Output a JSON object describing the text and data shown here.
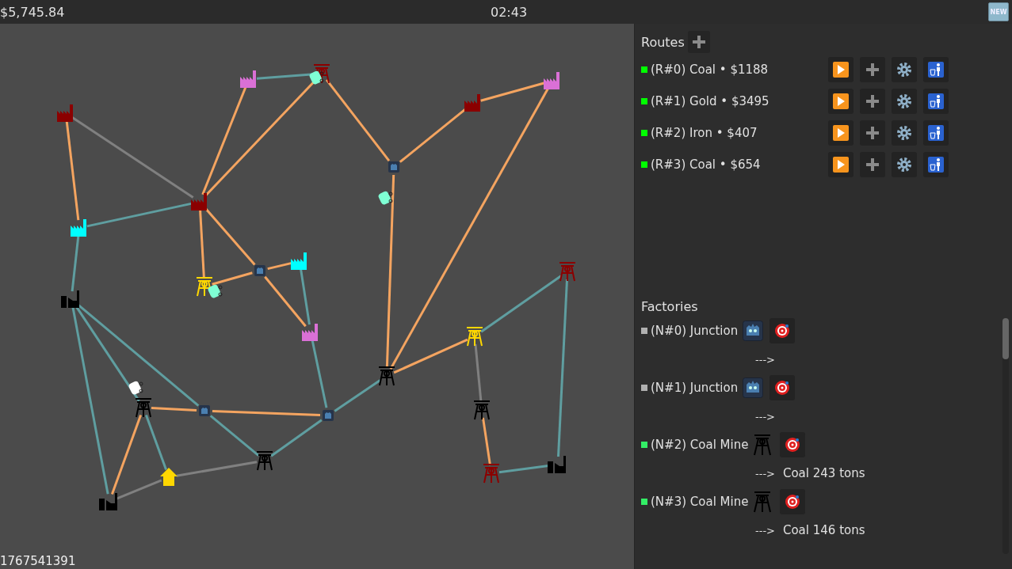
{
  "top_bar": {
    "balance": "$5,745.84",
    "clock": "02:43",
    "new_button": "NEW"
  },
  "map": {
    "seed": "1767541391",
    "nodes": [
      {
        "kind": "factory",
        "color": "#8b0000"
      },
      {
        "kind": "factory",
        "color": "#da70d6"
      },
      {
        "kind": "factory",
        "color": "#8b0000"
      },
      {
        "kind": "factory",
        "color": "#00ffff"
      },
      {
        "kind": "factory",
        "color": "#00ffff"
      },
      {
        "kind": "factory",
        "color": "#da70d6"
      },
      {
        "kind": "factory",
        "color": "#8b0000"
      },
      {
        "kind": "factory",
        "color": "#da70d6"
      },
      {
        "kind": "plant",
        "color": "#000000"
      },
      {
        "kind": "plant",
        "color": "#000000"
      },
      {
        "kind": "plant",
        "color": "#000000"
      },
      {
        "kind": "mine",
        "color": "#8b0000"
      },
      {
        "kind": "mine",
        "color": "#ffd700"
      },
      {
        "kind": "mine",
        "color": "#000000"
      },
      {
        "kind": "mine",
        "color": "#000000"
      },
      {
        "kind": "mine",
        "color": "#000000"
      },
      {
        "kind": "mine",
        "color": "#ffd700"
      },
      {
        "kind": "mine",
        "color": "#000000"
      },
      {
        "kind": "mine",
        "color": "#8b0000"
      },
      {
        "kind": "mine",
        "color": "#8b0000"
      },
      {
        "kind": "junction"
      },
      {
        "kind": "junction"
      },
      {
        "kind": "junction"
      },
      {
        "kind": "junction"
      },
      {
        "kind": "depot",
        "color": "#ffd700"
      },
      {
        "kind": "truck",
        "color": "#7fffd4"
      },
      {
        "kind": "truck",
        "color": "#7fffd4"
      },
      {
        "kind": "truck",
        "color": "#7fffd4"
      },
      {
        "kind": "truck",
        "color": "#ffffff"
      }
    ]
  },
  "routes": {
    "title": "Routes",
    "items": [
      {
        "label": "(R#0) Coal • $1188",
        "color": "#00ff00"
      },
      {
        "label": "(R#1) Gold • $3495",
        "color": "#00ff00"
      },
      {
        "label": "(R#2) Iron • $407",
        "color": "#00ff00"
      },
      {
        "label": "(R#3) Coal • $654",
        "color": "#00ff00"
      }
    ]
  },
  "factories": {
    "title": "Factories",
    "items": [
      {
        "label": "(N#0) Junction",
        "color": "#b0b0b0",
        "kind": "junction",
        "arrow": "--->"
      },
      {
        "label": "(N#1) Junction",
        "color": "#b0b0b0",
        "kind": "junction",
        "arrow": "--->"
      },
      {
        "label": "(N#2) Coal Mine",
        "color": "#33ee66",
        "kind": "mine",
        "arrow": "--->",
        "output": "Coal 243 tons"
      },
      {
        "label": "(N#3) Coal Mine",
        "color": "#33ee66",
        "kind": "mine",
        "arrow": "--->",
        "output": "Coal 146 tons"
      }
    ]
  }
}
